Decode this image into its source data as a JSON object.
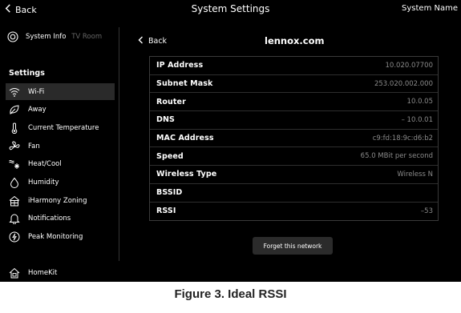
{
  "topbar": {
    "back_label": "Back",
    "title": "System Settings",
    "right_label": "System Name"
  },
  "sidebar": {
    "system_info_label": "System Info",
    "device_name": "TV Room",
    "settings_heading": "Settings",
    "items": [
      {
        "label": "Wi-Fi",
        "icon": "wifi-icon"
      },
      {
        "label": "Away",
        "icon": "away-leaf-icon"
      },
      {
        "label": "Current Temperature",
        "icon": "thermometer-icon"
      },
      {
        "label": "Fan",
        "icon": "fan-icon"
      },
      {
        "label": "Heat/Cool",
        "icon": "heat-cool-icon"
      },
      {
        "label": "Humidity",
        "icon": "humidity-drop-icon"
      },
      {
        "label": "iHarmony Zoning",
        "icon": "zoning-house-icon"
      },
      {
        "label": "Notifications",
        "icon": "bell-icon"
      },
      {
        "label": "Peak Monitoring",
        "icon": "peak-lightning-icon"
      },
      {
        "label": "HomeKit",
        "icon": "homekit-icon"
      }
    ]
  },
  "main": {
    "back_label": "Back",
    "title": "lennox.com",
    "rows": [
      {
        "label": "IP Address",
        "value": "10.020.07700"
      },
      {
        "label": "Subnet Mask",
        "value": "253.020.002.000"
      },
      {
        "label": "Router",
        "value": "10.0.05"
      },
      {
        "label": "DNS",
        "value": "– 10.0.01"
      },
      {
        "label": "MAC Address",
        "value": "c9:fd:18:9c:d6:b2"
      },
      {
        "label": "Speed",
        "value": "65.0 MBit per second"
      },
      {
        "label": "Wireless Type",
        "value": "Wireless N"
      },
      {
        "label": "BSSID",
        "value": ""
      },
      {
        "label": "RSSI",
        "value": "–53"
      }
    ],
    "forget_label": "Forget this network"
  },
  "caption": "Figure 3. Ideal RSSI",
  "colors": {
    "background": "#000000",
    "active_item": "#2a2a2a",
    "value_text": "#8a8a8a",
    "caption_text": "#222222"
  }
}
